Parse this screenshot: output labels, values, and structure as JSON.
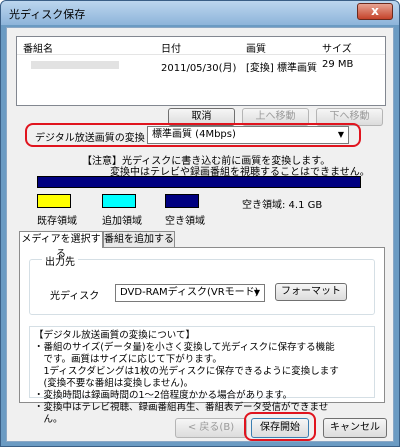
{
  "window": {
    "title": "光ディスク保存",
    "close_glyph": "x"
  },
  "list": {
    "columns": [
      "番組名",
      "日付",
      "画質",
      "サイズ"
    ],
    "rows": [
      {
        "date": "2011/05/30(月)",
        "quality": "[変換] 標準画質",
        "size": "29 MB"
      }
    ]
  },
  "buttons": {
    "cancel": "取消",
    "move_up": "上へ移動",
    "move_down": "下へ移動",
    "format": "フォーマット",
    "back": "< 戻る(B)",
    "start": "保存開始",
    "cancel_main": "キャンセル"
  },
  "conversion": {
    "label": "デジタル放送画質の変換",
    "value": "標準画質 (4Mbps)",
    "note1": "【注意】光ディスクに書き込む前に画質を変換します。",
    "note2": "変換中はテレビや録画番組を視聴することはできません。"
  },
  "usage": {
    "used_label": "既存領域",
    "added_label": "追加領域",
    "free_label": "空き領域",
    "free_text": "空き領域: 4.1 GB",
    "colors": {
      "used": "#ffff00",
      "added": "#00ffff",
      "free": "#000080"
    }
  },
  "tabs": [
    "メディアを選択する",
    "番組を追加する"
  ],
  "output": {
    "group_label": "出力先",
    "disc_label": "光ディスク",
    "disc_value": "DVD-RAMディスク(VRモード)"
  },
  "notes": [
    "【デジタル放送画質の変換について】",
    "・番組のサイズ(データ量)を小さく変換して光ディスクに保存する機能",
    "　です。画質はサイズに応じて下がります。",
    "　1ディスクダビングは1枚の光ディスクに保存できるように変換します",
    "　(変換不要な番組は変換しません)。",
    "・変換時間は録画時間の1〜2倍程度かかる場合があります。",
    "・変換中はテレビ視聴、録画番組再生、番組表データ受信ができませ",
    "　ん。"
  ]
}
